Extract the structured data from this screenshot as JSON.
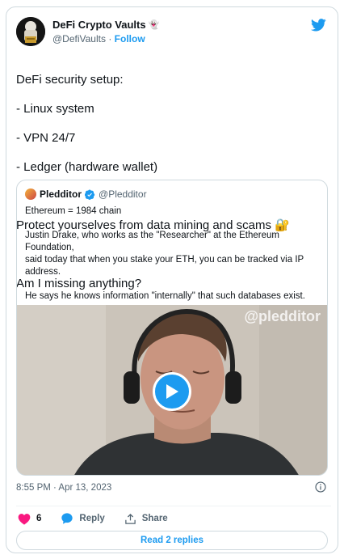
{
  "author": {
    "name": "DeFi Crypto Vaults",
    "handle": "@DefiVaults",
    "separator": "·",
    "follow_label": "Follow"
  },
  "tweet": {
    "lines": [
      "DeFi security setup:",
      "- Linux system",
      "- VPN 24/7",
      "- Ledger (hardware wallet)",
      "",
      "Protect yourselves from data mining and scams 🔐",
      "",
      "Am I missing anything?"
    ]
  },
  "quote": {
    "name": "Pledditor",
    "handle": "@Pledditor",
    "lines": [
      "Ethereum = 1984 chain",
      "",
      "Justin Drake, who works as the \"Researcher\" at the Ethereum Foundation,",
      "said today that when you stake your ETH, you can be tracked via IP",
      "address.",
      "",
      "He says he knows information \"internally\" that such databases exist."
    ],
    "watermark": "@pledditor"
  },
  "timestamp": "8:55 PM · Apr 13, 2023",
  "actions": {
    "like_count": "6",
    "reply_label": "Reply",
    "share_label": "Share"
  },
  "read_replies_label": "Read 2 replies",
  "colors": {
    "accent": "#1d9bf0",
    "like": "#f91880",
    "text": "#0f1419",
    "muted": "#536471",
    "border": "#cfd9de"
  },
  "icons": [
    "twitter-bird-icon",
    "verified-badge-icon",
    "ghost-emoji-icon",
    "lock-key-icon",
    "play-icon",
    "info-icon",
    "heart-icon",
    "reply-bubble-icon",
    "share-icon"
  ]
}
